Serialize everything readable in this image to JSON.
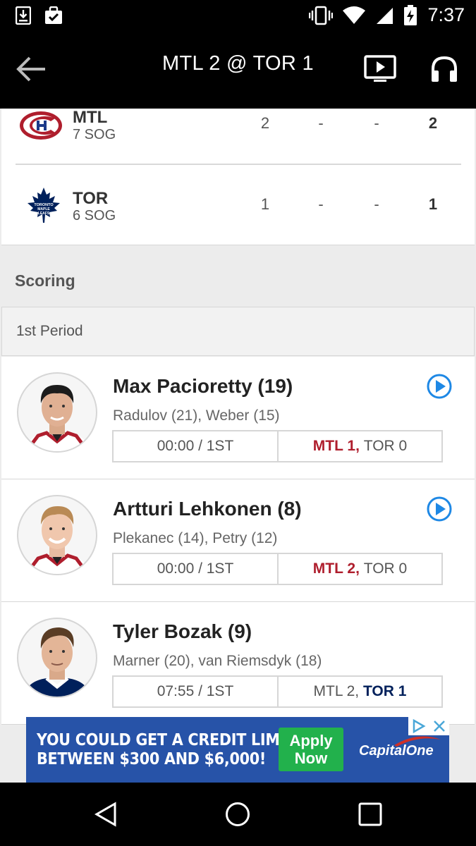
{
  "status": {
    "time": "7:37"
  },
  "header": {
    "title": "MTL 2 @ TOR 1"
  },
  "teams": [
    {
      "abbr": "MTL",
      "sog": "7 SOG",
      "p1": "2",
      "p2": "-",
      "p3": "-",
      "total": "2"
    },
    {
      "abbr": "TOR",
      "sog": "6 SOG",
      "p1": "1",
      "p2": "-",
      "p3": "-",
      "total": "1"
    }
  ],
  "scoring": {
    "title": "Scoring",
    "period": "1st Period",
    "goals": [
      {
        "scorer": "Max Pacioretty (19)",
        "assists": "Radulov (21), Weber (15)",
        "time": "00:00 / 1ST",
        "mtl": "MTL 1,",
        "tor": "TOR 0"
      },
      {
        "scorer": "Artturi Lehkonen (8)",
        "assists": "Plekanec (14), Petry (12)",
        "time": "00:00 / 1ST",
        "mtl": "MTL 2,",
        "tor": "TOR 0"
      },
      {
        "scorer": "Tyler Bozak (9)",
        "assists": "Marner (20), van Riemsdyk (18)",
        "time": "07:55 / 1ST",
        "mtl": "MTL 2,",
        "tor": "TOR 1"
      }
    ]
  },
  "ad": {
    "line1": "YOU COULD GET A CREDIT LIMIT",
    "line2": "BETWEEN $300 AND $6,000!",
    "cta_line1": "Apply",
    "cta_line2": "Now",
    "brand": "CapitalOne"
  },
  "colors": {
    "mtl": "#af1e2d",
    "tor": "#00205b",
    "play": "#1e88e5",
    "ad_bg": "#2753a8",
    "ad_cta": "#22b14c"
  }
}
